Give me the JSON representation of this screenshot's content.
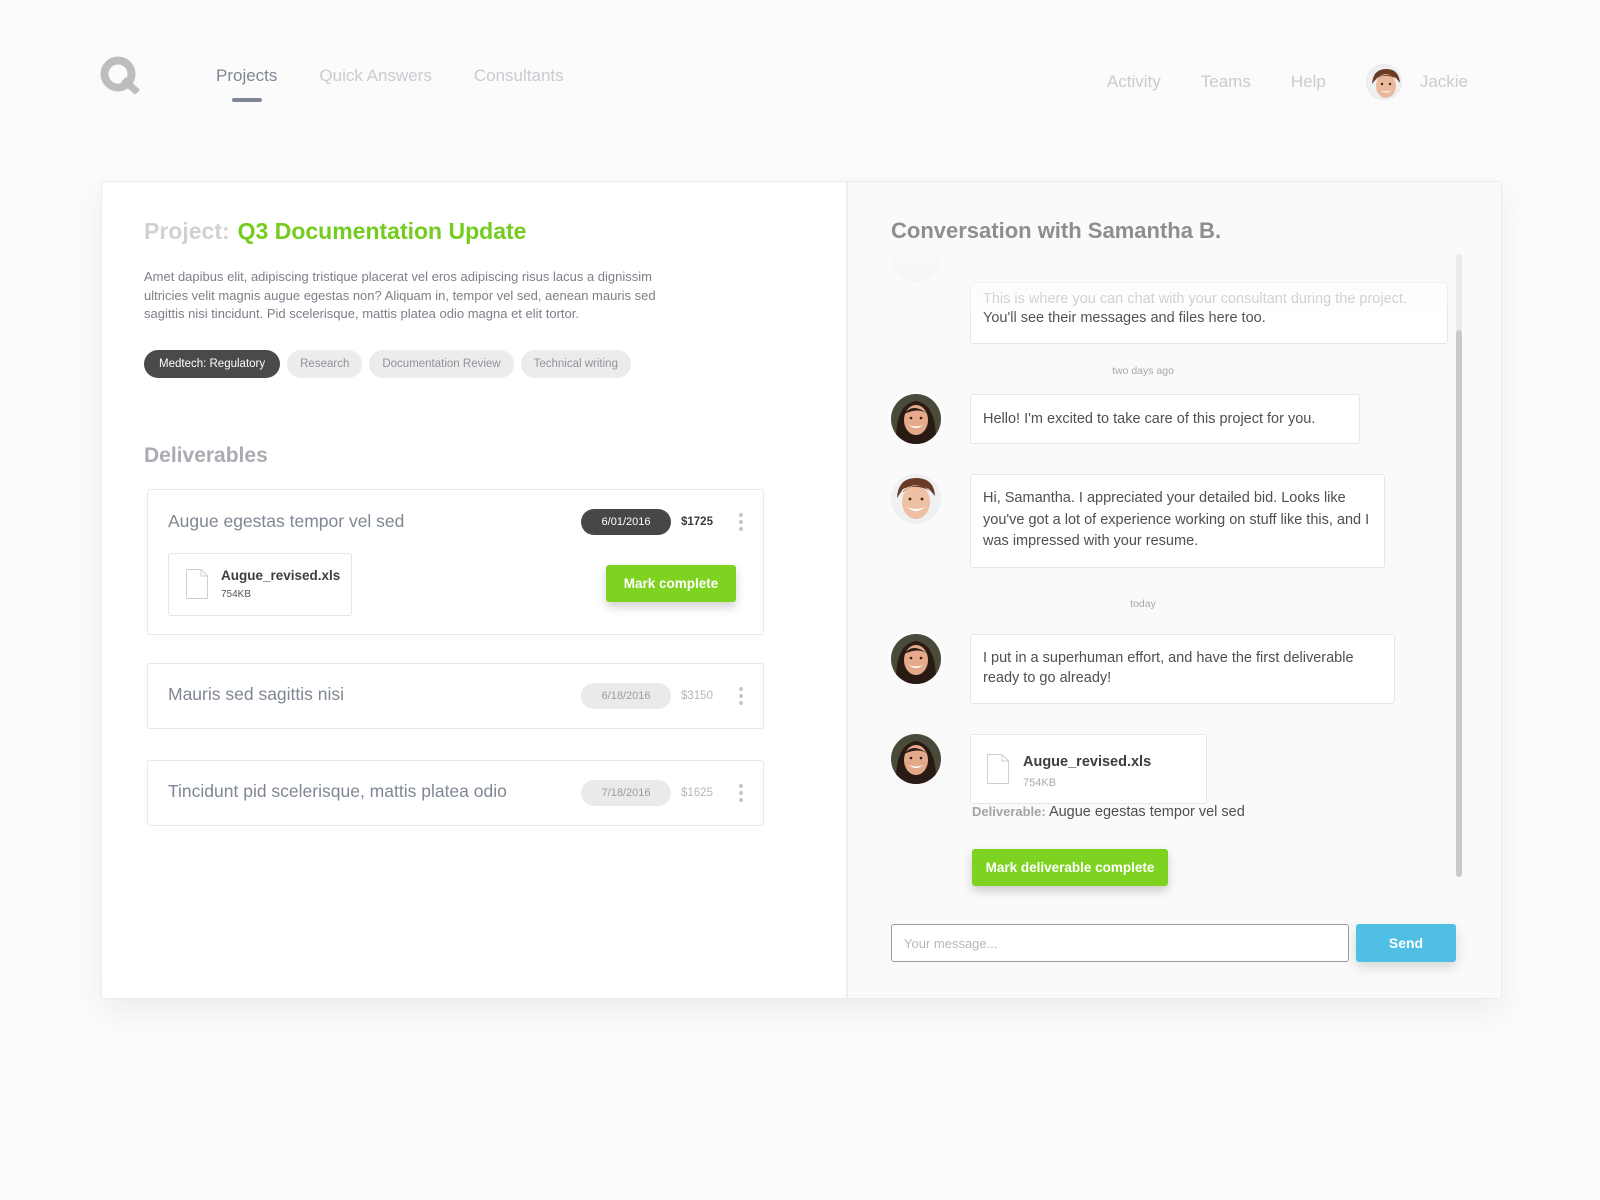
{
  "nav": {
    "logo": "Q",
    "left": [
      {
        "label": "Projects",
        "active": true
      },
      {
        "label": "Quick Answers",
        "active": false
      },
      {
        "label": "Consultants",
        "active": false
      }
    ],
    "right": [
      {
        "label": "Activity"
      },
      {
        "label": "Teams"
      },
      {
        "label": "Help"
      }
    ],
    "user": {
      "name": "Jackie",
      "avatar": "user-avatar-jackie"
    }
  },
  "project": {
    "label": "Project:",
    "name": "Q3 Documentation Update",
    "description": "Amet dapibus elit, adipiscing tristique placerat vel eros adipiscing risus lacus a dignissim ultricies velit magnis augue egestas non? Aliquam in, tempor vel sed, aenean mauris sed sagittis nisi tincidunt. Pid scelerisque, mattis platea odio magna et elit tortor.",
    "tags": [
      {
        "label": "Medtech: Regulatory",
        "selected": true
      },
      {
        "label": "Research",
        "selected": false
      },
      {
        "label": "Documentation Review",
        "selected": false
      },
      {
        "label": "Technical writing",
        "selected": false
      }
    ],
    "accent_color": "#74cc1e"
  },
  "deliverables": {
    "heading": "Deliverables",
    "items": [
      {
        "title": "Augue egestas tempor vel sed",
        "date": "6/01/2016",
        "price": "$1725",
        "active": true,
        "file": {
          "name": "Augue_revised.xls",
          "size": "754KB"
        },
        "action": "Mark complete"
      },
      {
        "title": "Mauris sed sagittis nisi",
        "date": "6/18/2016",
        "price": "$3150",
        "active": false
      },
      {
        "title": "Tincidunt pid scelerisque, mattis platea odio",
        "date": "7/18/2016",
        "price": "$1625",
        "active": false
      }
    ]
  },
  "conversation": {
    "title": "Conversation with Samantha B.",
    "intro": {
      "line1": "This is where you can chat with your consultant during the project.",
      "line2": "You'll see their messages and files here too."
    },
    "stamps": [
      "two days ago",
      "today"
    ],
    "messages": [
      {
        "sender": "Samantha B.",
        "avatar": "consultant-avatar",
        "text": "Hello! I'm excited to take care of this project for you."
      },
      {
        "sender": "Jackie",
        "avatar": "user-avatar",
        "text": "Hi, Samantha. I appreciated your detailed bid. Looks like you've got a lot of experience working on stuff like this, and I was impressed with your resume."
      },
      {
        "sender": "Samantha B.",
        "avatar": "consultant-avatar",
        "text": "I put in a superhuman effort, and have the first deliverable ready to go already!"
      },
      {
        "sender": "Samantha B.",
        "avatar": "consultant-avatar",
        "file": {
          "name": "Augue_revised.xls",
          "size": "754KB"
        },
        "deliverable_label": "Deliverable:",
        "deliverable_name": "Augue egestas tempor vel sed",
        "action": "Mark deliverable complete"
      }
    ],
    "input": {
      "placeholder": "Your message...",
      "value": ""
    },
    "send_label": "Send",
    "send_color": "#50bfe6",
    "scroll_position": 0.12
  }
}
